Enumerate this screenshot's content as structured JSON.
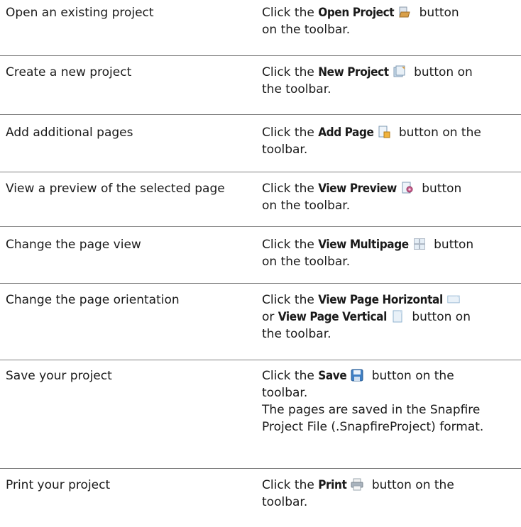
{
  "rows": [
    {
      "task": "Open an existing project",
      "action_lines": [
        {
          "pre": "Click the ",
          "cmd": "Open Project",
          "icon": "open-project-icon",
          "post": " button"
        },
        {
          "pre": "on the toolbar.",
          "cmd": "",
          "icon": "",
          "post": ""
        }
      ]
    },
    {
      "task": "Create a new project",
      "action_lines": [
        {
          "pre": "Click the ",
          "cmd": "New Project",
          "icon": "new-project-icon",
          "post": " button on"
        },
        {
          "pre": "the toolbar.",
          "cmd": "",
          "icon": "",
          "post": ""
        }
      ]
    },
    {
      "task": "Add additional pages",
      "action_lines": [
        {
          "pre": "Click the ",
          "cmd": "Add Page",
          "icon": "add-page-icon",
          "post": " button on the"
        },
        {
          "pre": "toolbar.",
          "cmd": "",
          "icon": "",
          "post": ""
        }
      ]
    },
    {
      "task": "View a preview of the selected page",
      "action_lines": [
        {
          "pre": "Click the ",
          "cmd": "View Preview",
          "icon": "view-preview-icon",
          "post": " button"
        },
        {
          "pre": "on the toolbar.",
          "cmd": "",
          "icon": "",
          "post": ""
        }
      ]
    },
    {
      "task": "Change the page view",
      "action_lines": [
        {
          "pre": "Click the ",
          "cmd": "View Multipage",
          "icon": "view-multipage-icon",
          "post": " button"
        },
        {
          "pre": "on the toolbar.",
          "cmd": "",
          "icon": "",
          "post": ""
        }
      ]
    },
    {
      "task": "Change the page orientation",
      "action_lines": [
        {
          "pre": "Click the ",
          "cmd": "View Page Horizontal",
          "icon": "view-page-horizontal-icon",
          "post": ""
        },
        {
          "pre": "or ",
          "cmd": "View Page Vertical",
          "icon": "view-page-vertical-icon",
          "post": " button on"
        },
        {
          "pre": "the toolbar.",
          "cmd": "",
          "icon": "",
          "post": ""
        }
      ]
    },
    {
      "task": "Save your project",
      "action_lines": [
        {
          "pre": "Click the ",
          "cmd": "Save",
          "icon": "save-icon",
          "post": " button on the"
        },
        {
          "pre": "toolbar.",
          "cmd": "",
          "icon": "",
          "post": ""
        },
        {
          "pre": "The pages are saved in the Snapfire",
          "cmd": "",
          "icon": "",
          "post": ""
        },
        {
          "pre": "Project File (.SnapfireProject) format.",
          "cmd": "",
          "icon": "",
          "post": ""
        }
      ]
    },
    {
      "task": "Print your project",
      "action_lines": [
        {
          "pre": "Click the ",
          "cmd": "Print",
          "icon": "print-icon",
          "post": " button on the"
        },
        {
          "pre": "toolbar.",
          "cmd": "",
          "icon": "",
          "post": ""
        }
      ]
    }
  ]
}
